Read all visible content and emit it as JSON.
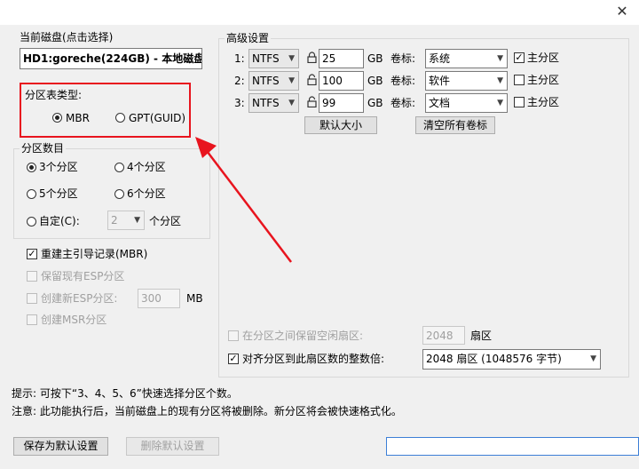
{
  "disk": {
    "label": "当前磁盘(点击选择)",
    "value": "HD1:goreche(224GB) - 本地磁盘(G"
  },
  "partition_type": {
    "label": "分区表类型:",
    "options": [
      "MBR",
      "GPT(GUID)"
    ],
    "selected": "MBR"
  },
  "partition_count": {
    "label": "分区数目",
    "options": [
      "3个分区",
      "4个分区",
      "5个分区",
      "6个分区"
    ],
    "selected": "3个分区",
    "custom_label": "自定(C):",
    "custom_value": "2",
    "custom_suffix": "个分区"
  },
  "options": {
    "rebuild_mbr": "重建主引导记录(MBR)",
    "rebuild_mbr_checked": true,
    "keep_esp": "保留现有ESP分区",
    "create_esp": "创建新ESP分区:",
    "esp_size": "300",
    "esp_unit": "MB",
    "create_msr": "创建MSR分区"
  },
  "advanced": {
    "label": "高级设置",
    "volume_label": "卷标:",
    "primary_label": "主分区",
    "unit": "GB",
    "rows": [
      {
        "index": "1:",
        "fs": "NTFS",
        "size": "25",
        "volume": "系统",
        "primary": true,
        "locked": true
      },
      {
        "index": "2:",
        "fs": "NTFS",
        "size": "100",
        "volume": "软件",
        "primary": false,
        "locked": false
      },
      {
        "index": "3:",
        "fs": "NTFS",
        "size": "99",
        "volume": "文档",
        "primary": false,
        "locked": false
      }
    ],
    "default_size_button": "默认大小",
    "clear_labels_button": "清空所有卷标",
    "reserve_sectors_label": "在分区之间保留空闲扇区:",
    "reserve_sectors_value": "2048",
    "reserve_sectors_unit": "扇区",
    "align_label": "对齐分区到此扇区数的整数倍:",
    "align_checked": true,
    "align_value": "2048 扇区 (1048576 字节)"
  },
  "notes": {
    "tip": "提示: 可按下“3、4、5、6”快速选择分区个数。",
    "warning": "注意: 此功能执行后，当前磁盘上的现有分区将被删除。新分区将会被快速格式化。"
  },
  "buttons": {
    "save_default": "保存为默认设置",
    "delete_default": "删除默认设置"
  },
  "colors": {
    "highlight_red": "#e8141e",
    "accent_blue": "#3c7fd6"
  }
}
